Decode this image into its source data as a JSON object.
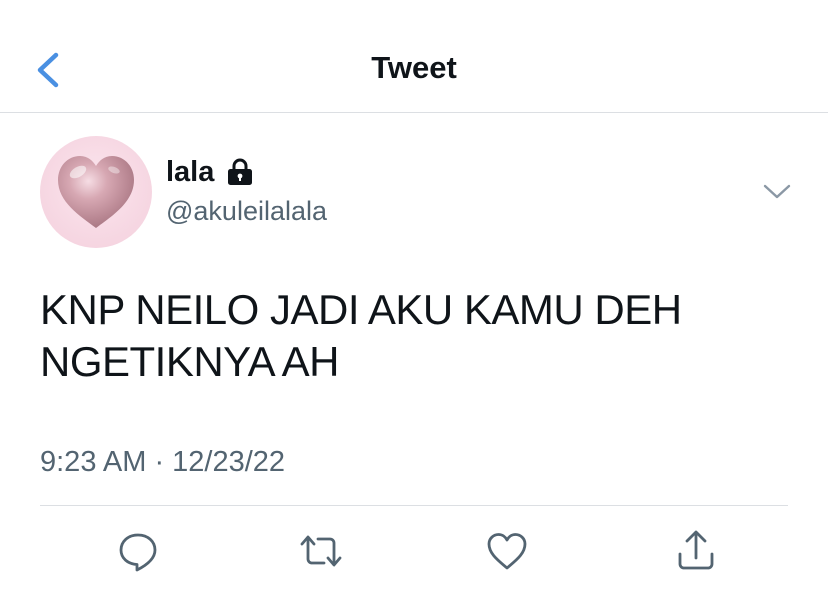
{
  "header": {
    "title": "Tweet",
    "back_icon": "chevron-left-icon",
    "accent_color": "#4a90e2"
  },
  "tweet": {
    "author": {
      "display_name": "lala",
      "handle": "@akuleilalala",
      "protected_icon": "lock-icon",
      "avatar": "pink-heart-avatar"
    },
    "menu_icon": "chevron-down-icon",
    "text_line1": "KNP NEILO JADI AKU KAMU DEH",
    "text_line2": "NGETIKNYA AH",
    "timestamp": "9:23 AM · 12/23/22"
  },
  "actions": [
    {
      "name": "reply",
      "icon": "reply-icon"
    },
    {
      "name": "retweet",
      "icon": "retweet-icon"
    },
    {
      "name": "like",
      "icon": "heart-icon"
    },
    {
      "name": "share",
      "icon": "share-icon"
    }
  ],
  "colors": {
    "text_primary": "#0f1419",
    "text_secondary": "#536471",
    "divider": "#dcdfe3",
    "icon_gray": "#536471"
  }
}
